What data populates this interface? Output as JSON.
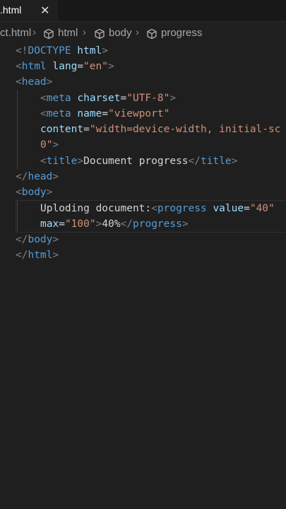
{
  "tab": {
    "name": ".html",
    "close": "✕"
  },
  "breadcrumb": {
    "file": "ct.html",
    "items": [
      "html",
      "body",
      "progress"
    ]
  },
  "code": {
    "doctype_open": "<!",
    "doctype_kw": "DOCTYPE",
    "doctype_rest": " html",
    "html_tag": "html",
    "lang_attr": "lang",
    "lang_val": "\"en\"",
    "head_tag": "head",
    "meta_tag": "meta",
    "charset_attr": "charset",
    "charset_val": "\"UTF-8\"",
    "name_attr": "name",
    "name_val": "\"viewport\"",
    "content_attr": "content",
    "content_val": "\"width=device-width, initial-sc",
    "content_val_end": "0\"",
    "title_tag": "title",
    "title_text": "Document progress",
    "body_tag": "body",
    "body_text": "Uploding document:",
    "progress_tag": "progress",
    "value_attr": "value",
    "value_val": "\"40\"",
    "max_attr": "max",
    "max_val": "\"100\"",
    "progress_text": "40%"
  }
}
